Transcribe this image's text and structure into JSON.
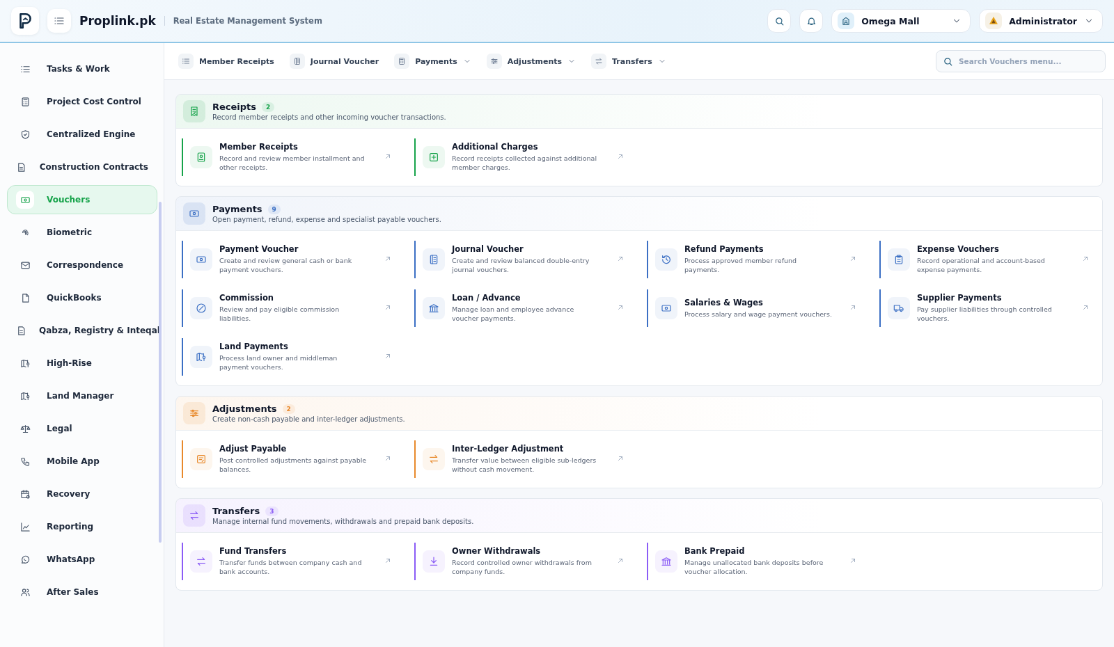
{
  "header": {
    "brand": "Proplink.pk",
    "subtitle": "Real Estate Management System",
    "project": "Omega Mall",
    "user": "Administrator"
  },
  "sidebar": {
    "items": [
      {
        "label": "Tasks & Work",
        "selected": false
      },
      {
        "label": "Project Cost Control",
        "selected": false
      },
      {
        "label": "Centralized Engine",
        "selected": false
      },
      {
        "label": "Construction Contracts",
        "selected": false
      },
      {
        "label": "Vouchers",
        "selected": true
      },
      {
        "label": "Biometric",
        "selected": false
      },
      {
        "label": "Correspondence",
        "selected": false
      },
      {
        "label": "QuickBooks",
        "selected": false
      },
      {
        "label": "Qabza, Registry & Inteqal",
        "selected": false
      },
      {
        "label": "High-Rise",
        "selected": false
      },
      {
        "label": "Land Manager",
        "selected": false
      },
      {
        "label": "Legal",
        "selected": false
      },
      {
        "label": "Mobile App",
        "selected": false
      },
      {
        "label": "Recovery",
        "selected": false
      },
      {
        "label": "Reporting",
        "selected": false
      },
      {
        "label": "WhatsApp",
        "selected": false
      },
      {
        "label": "After Sales",
        "selected": false
      }
    ]
  },
  "subnav": {
    "items": [
      {
        "label": "Member Receipts",
        "dropdown": false
      },
      {
        "label": "Journal Voucher",
        "dropdown": false
      },
      {
        "label": "Payments",
        "dropdown": true
      },
      {
        "label": "Adjustments",
        "dropdown": true
      },
      {
        "label": "Transfers",
        "dropdown": true
      }
    ],
    "search": {
      "placeholder": "Search Vouchers menu..."
    }
  },
  "sections": [
    {
      "title": "Receipts",
      "count": "2",
      "description": "Record member receipts and other incoming voucher transactions.",
      "color": "#16a34a",
      "items": [
        {
          "title": "Member Receipts",
          "description": "Record and review member installment and other receipts."
        },
        {
          "title": "Additional Charges",
          "description": "Record receipts collected against additional member charges."
        }
      ]
    },
    {
      "title": "Payments",
      "count": "9",
      "description": "Open payment, refund, expense and specialist payable vouchers.",
      "color": "#3b6fc4",
      "items": [
        {
          "title": "Payment Voucher",
          "description": "Create and review general cash or bank payment vouchers."
        },
        {
          "title": "Journal Voucher",
          "description": "Create and review balanced double-entry journal vouchers."
        },
        {
          "title": "Refund Payments",
          "description": "Process approved member refund payments."
        },
        {
          "title": "Expense Vouchers",
          "description": "Record operational and account-based expense payments."
        },
        {
          "title": "Commission",
          "description": "Review and pay eligible commission liabilities."
        },
        {
          "title": "Loan / Advance",
          "description": "Manage loan and employee advance voucher payments."
        },
        {
          "title": "Salaries & Wages",
          "description": "Process salary and wage payment vouchers."
        },
        {
          "title": "Supplier Payments",
          "description": "Pay supplier liabilities through controlled vouchers."
        },
        {
          "title": "Land Payments",
          "description": "Process land owner and middleman payment vouchers."
        }
      ]
    },
    {
      "title": "Adjustments",
      "count": "2",
      "description": "Create non-cash payable and inter-ledger adjustments.",
      "color": "#e8892b",
      "items": [
        {
          "title": "Adjust Payable",
          "description": "Post controlled adjustments against payable balances."
        },
        {
          "title": "Inter-Ledger Adjustment",
          "description": "Transfer value between eligible sub-ledgers without cash movement."
        }
      ]
    },
    {
      "title": "Transfers",
      "count": "3",
      "description": "Manage internal fund movements, withdrawals and prepaid bank deposits.",
      "color": "#8b5cf6",
      "items": [
        {
          "title": "Fund Transfers",
          "description": "Transfer funds between company cash and bank accounts."
        },
        {
          "title": "Owner Withdrawals",
          "description": "Record controlled owner withdrawals from company funds."
        },
        {
          "title": "Bank Prepaid",
          "description": "Manage unallocated bank deposits before voucher allocation."
        }
      ]
    }
  ]
}
